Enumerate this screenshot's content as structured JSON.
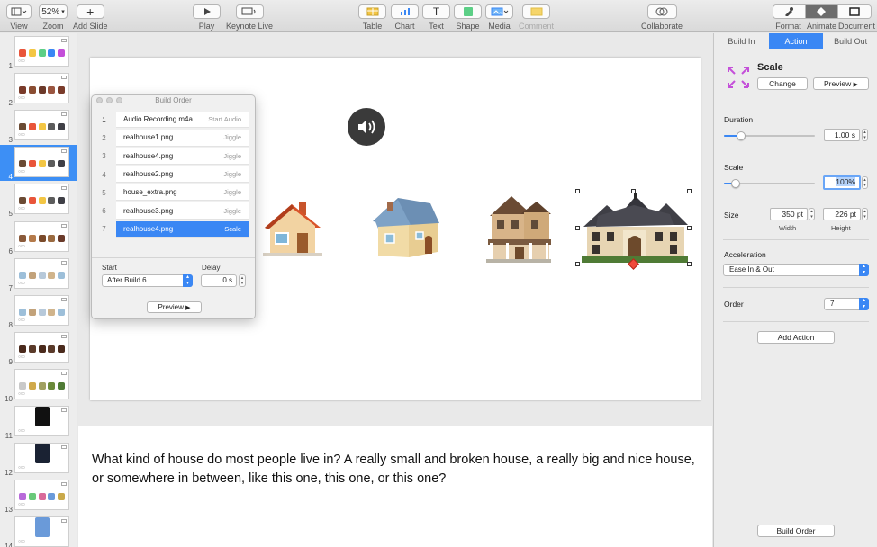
{
  "toolbar": {
    "view": "View",
    "zoom_value": "52%",
    "zoom": "Zoom",
    "add_slide": "Add Slide",
    "play": "Play",
    "keynote_live": "Keynote Live",
    "table": "Table",
    "chart": "Chart",
    "text": "Text",
    "text_glyph": "T",
    "shape": "Shape",
    "media": "Media",
    "comment": "Comment",
    "collaborate": "Collaborate",
    "format": "Format",
    "animate": "Animate",
    "document": "Document"
  },
  "slides": [
    {
      "num": "1"
    },
    {
      "num": "2"
    },
    {
      "num": "3"
    },
    {
      "num": "4"
    },
    {
      "num": "5"
    },
    {
      "num": "6"
    },
    {
      "num": "7"
    },
    {
      "num": "8"
    },
    {
      "num": "9"
    },
    {
      "num": "10"
    },
    {
      "num": "11"
    },
    {
      "num": "12"
    },
    {
      "num": "13"
    },
    {
      "num": "14"
    }
  ],
  "selected_slide": "4",
  "build_order": {
    "title": "Build Order",
    "items": [
      {
        "num": "1",
        "name": "Audio Recording.m4a",
        "effect": "Start Audio"
      },
      {
        "num": "2",
        "name": "realhouse1.png",
        "effect": "Jiggle"
      },
      {
        "num": "3",
        "name": "realhouse4.png",
        "effect": "Jiggle"
      },
      {
        "num": "4",
        "name": "realhouse2.png",
        "effect": "Jiggle"
      },
      {
        "num": "5",
        "name": "house_extra.png",
        "effect": "Jiggle"
      },
      {
        "num": "6",
        "name": "realhouse3.png",
        "effect": "Jiggle"
      },
      {
        "num": "7",
        "name": "realhouse4.png",
        "effect": "Scale"
      }
    ],
    "start_label": "Start",
    "start_value": "After Build 6",
    "delay_label": "Delay",
    "delay_value": "0 s",
    "preview": "Preview"
  },
  "notes": "What kind of house do most people live in? A really small and broken house, a really big and nice house, or somewhere in between, like this one, this one, or this one?",
  "inspector": {
    "tabs": [
      "Build In",
      "Action",
      "Build Out"
    ],
    "effect_name": "Scale",
    "change": "Change",
    "preview": "Preview",
    "duration_label": "Duration",
    "duration_value": "1.00 s",
    "scale_label": "Scale",
    "scale_value": "100%",
    "size_label": "Size",
    "width_value": "350 pt",
    "height_value": "226 pt",
    "width_label": "Width",
    "height_label": "Height",
    "acceleration_label": "Acceleration",
    "acceleration_value": "Ease In & Out",
    "order_label": "Order",
    "order_value": "7",
    "add_action": "Add Action",
    "build_order": "Build Order"
  },
  "colors": {
    "accent": "#3a87f4"
  }
}
